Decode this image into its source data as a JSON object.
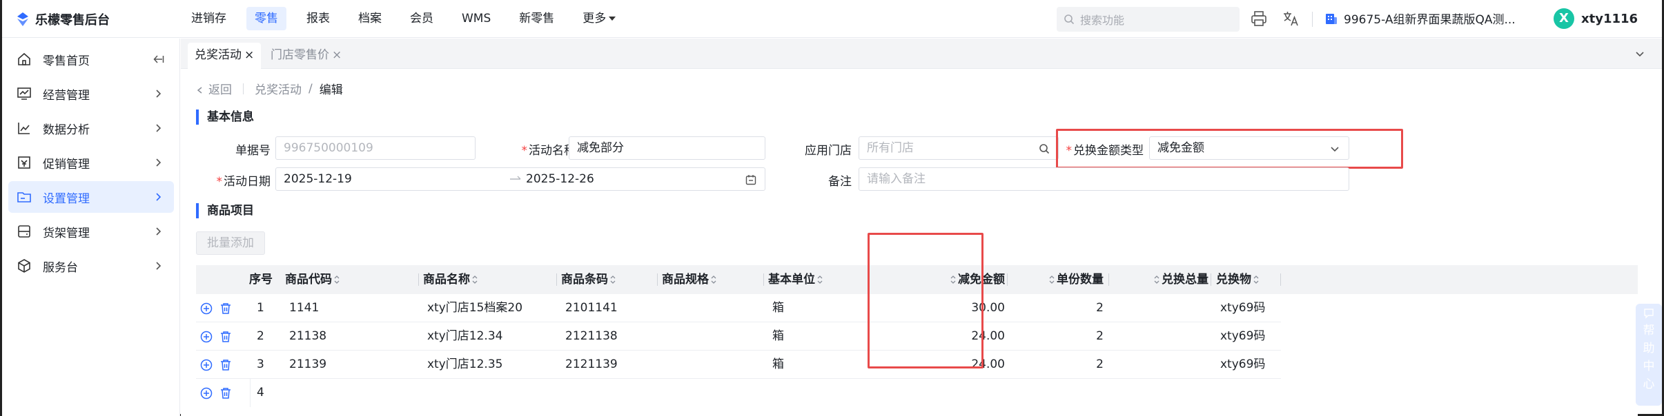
{
  "app": {
    "name": "乐檬零售后台",
    "brand_color": "#2f6bff"
  },
  "topnav": {
    "items": [
      {
        "label": "进销存"
      },
      {
        "label": "零售",
        "active": true
      },
      {
        "label": "报表"
      },
      {
        "label": "档案"
      },
      {
        "label": "会员"
      },
      {
        "label": "WMS"
      },
      {
        "label": "新零售"
      },
      {
        "label": "更多"
      }
    ],
    "search_placeholder": "搜索功能",
    "store": "99675-A组新界面果蔬版QA测...",
    "user_initial": "X",
    "user_name": "xty1116"
  },
  "sidebar": {
    "items": [
      {
        "label": "零售首页",
        "icon": "home-icon"
      },
      {
        "label": "经营管理",
        "icon": "monitor-icon"
      },
      {
        "label": "数据分析",
        "icon": "chart-icon"
      },
      {
        "label": "促销管理",
        "icon": "promo-icon"
      },
      {
        "label": "设置管理",
        "icon": "folder-icon",
        "active": true
      },
      {
        "label": "货架管理",
        "icon": "shelf-icon"
      },
      {
        "label": "服务台",
        "icon": "box-icon"
      }
    ]
  },
  "tabs": [
    {
      "label": "兑奖活动",
      "active": true
    },
    {
      "label": "门店零售价",
      "active": false
    }
  ],
  "breadcrumb": {
    "back": "返回",
    "parent": "兑奖活动",
    "sep": "/",
    "current": "编辑"
  },
  "basic": {
    "title": "基本信息",
    "doc_no_label": "单据号",
    "doc_no_placeholder": "996750000109",
    "activity_name_label": "活动名称",
    "activity_name_value": "减免部分",
    "store_label": "应用门店",
    "store_placeholder": "所有门店",
    "amount_type_label": "兑换金额类型",
    "amount_type_value": "减免金额",
    "date_label": "活动日期",
    "date_start": "2025-12-19",
    "date_end": "2025-12-26",
    "remark_label": "备注",
    "remark_placeholder": "请输入备注"
  },
  "items": {
    "title": "商品项目",
    "batch_add": "批量添加",
    "columns": [
      "序号",
      "商品代码",
      "商品名称",
      "商品条码",
      "商品规格",
      "基本单位",
      "减免金额",
      "单份数量",
      "兑换总量",
      "兑换物"
    ],
    "rows": [
      {
        "seq": "1",
        "code": "1141",
        "name": "xty门店15档案20",
        "barcode": "2101141",
        "spec": "",
        "unit": "箱",
        "discount": "30.00",
        "qty": "2",
        "total": "",
        "gift": "xty69码"
      },
      {
        "seq": "2",
        "code": "21138",
        "name": "xty门店12.34",
        "barcode": "2121138",
        "spec": "",
        "unit": "箱",
        "discount": "24.00",
        "qty": "2",
        "total": "",
        "gift": "xty69码"
      },
      {
        "seq": "3",
        "code": "21139",
        "name": "xty门店12.35",
        "barcode": "2121139",
        "spec": "",
        "unit": "箱",
        "discount": "24.00",
        "qty": "2",
        "total": "",
        "gift": "xty69码"
      },
      {
        "seq": "4",
        "code": "",
        "name": "",
        "barcode": "",
        "spec": "",
        "unit": "",
        "discount": "",
        "qty": "",
        "total": "",
        "gift": ""
      }
    ]
  },
  "help": {
    "label": "帮助中心"
  }
}
